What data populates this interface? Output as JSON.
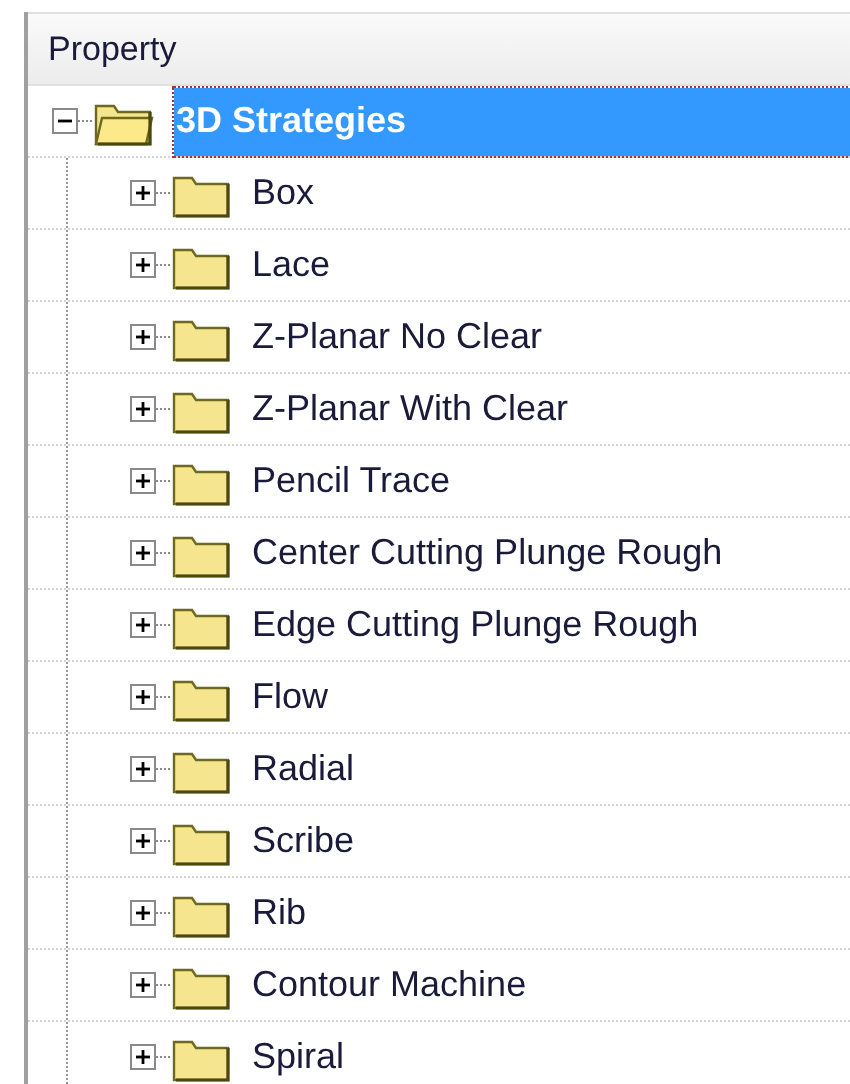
{
  "header": {
    "title": "Property"
  },
  "tree": [
    {
      "label": "3D Strategies",
      "selected": true,
      "expanded": true,
      "children": [
        {
          "label": "Box",
          "selected": false,
          "expanded": false
        },
        {
          "label": "Lace",
          "selected": false,
          "expanded": false
        },
        {
          "label": "Z-Planar No Clear",
          "selected": false,
          "expanded": false
        },
        {
          "label": "Z-Planar With Clear",
          "selected": false,
          "expanded": false
        },
        {
          "label": "Pencil Trace",
          "selected": false,
          "expanded": false
        },
        {
          "label": "Center Cutting Plunge Rough",
          "selected": false,
          "expanded": false
        },
        {
          "label": "Edge Cutting Plunge Rough",
          "selected": false,
          "expanded": false
        },
        {
          "label": "Flow",
          "selected": false,
          "expanded": false
        },
        {
          "label": "Radial",
          "selected": false,
          "expanded": false
        },
        {
          "label": "Scribe",
          "selected": false,
          "expanded": false
        },
        {
          "label": "Rib",
          "selected": false,
          "expanded": false
        },
        {
          "label": "Contour Machine",
          "selected": false,
          "expanded": false
        },
        {
          "label": "Spiral",
          "selected": false,
          "expanded": false
        }
      ]
    }
  ]
}
